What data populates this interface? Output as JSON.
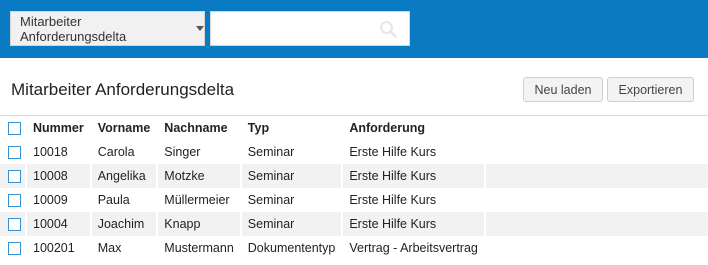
{
  "toolbar": {
    "report_selector_label": "Mitarbeiter Anforderungsdelta",
    "search_value": "",
    "search_placeholder": ""
  },
  "page": {
    "title": "Mitarbeiter Anforderungsdelta",
    "reload_label": "Neu laden",
    "export_label": "Exportieren"
  },
  "table": {
    "headers": {
      "number": "Nummer",
      "first_name": "Vorname",
      "last_name": "Nachname",
      "type": "Typ",
      "requirement": "Anforderung"
    },
    "rows": [
      {
        "number": "10018",
        "first_name": "Carola",
        "last_name": "Singer",
        "type": "Seminar",
        "requirement": "Erste Hilfe Kurs"
      },
      {
        "number": "10008",
        "first_name": "Angelika",
        "last_name": "Motzke",
        "type": "Seminar",
        "requirement": "Erste Hilfe Kurs"
      },
      {
        "number": "10009",
        "first_name": "Paula",
        "last_name": "Müllermeier",
        "type": "Seminar",
        "requirement": "Erste Hilfe Kurs"
      },
      {
        "number": "10004",
        "first_name": "Joachim",
        "last_name": "Knapp",
        "type": "Seminar",
        "requirement": "Erste Hilfe Kurs"
      },
      {
        "number": "100201",
        "first_name": "Max",
        "last_name": "Mustermann",
        "type": "Dokumententyp",
        "requirement": "Vertrag - Arbeitsvertrag"
      }
    ]
  },
  "colors": {
    "topbar": "#0a7bc2",
    "checkbox_border": "#3a8fd0",
    "row_alt": "#f2f2f2"
  },
  "icons": {
    "selector_caret": "chevron-down-icon",
    "search": "search-icon"
  }
}
